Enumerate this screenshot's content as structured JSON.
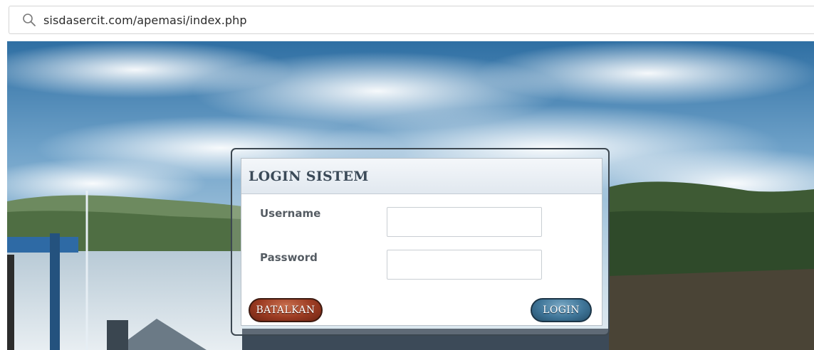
{
  "browser": {
    "url": "sisdasercit.com/apemasi/index.php"
  },
  "login": {
    "title": "LOGIN SISTEM",
    "username_label": "Username",
    "username_value": "",
    "password_label": "Password",
    "password_value": "",
    "cancel_label": "BATALKAN",
    "login_label": "LOGIN"
  },
  "icons": {
    "address_bar": "search-icon"
  },
  "colors": {
    "cancel_button": "#9b3b22",
    "login_button": "#3f7598",
    "header_text": "#3b4a58"
  }
}
